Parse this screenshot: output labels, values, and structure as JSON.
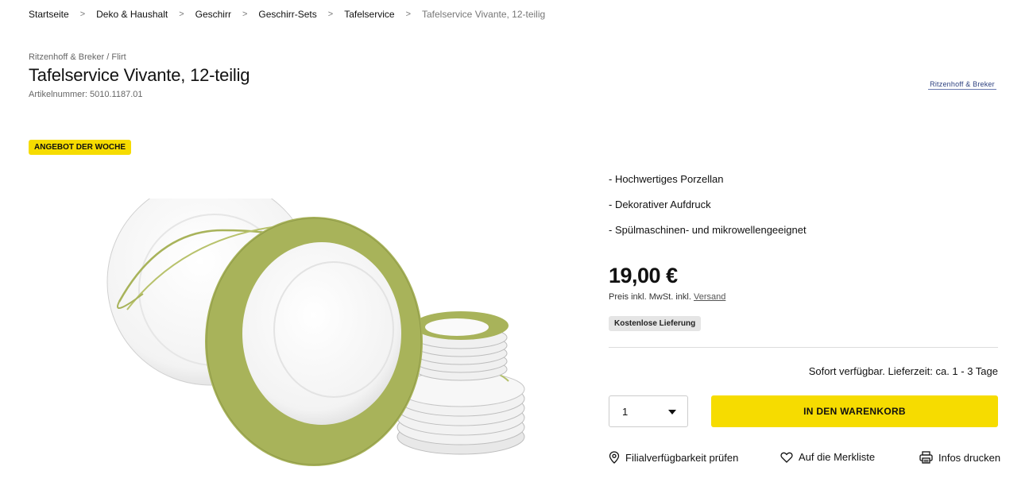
{
  "breadcrumb": {
    "items": [
      "Startseite",
      "Deko & Haushalt",
      "Geschirr",
      "Geschirr-Sets",
      "Tafelservice"
    ],
    "current": "Tafelservice Vivante, 12-teilig"
  },
  "product": {
    "brand_line": "Ritzenhoff & Breker / Flirt",
    "title": "Tafelservice Vivante, 12-teilig",
    "article_number": "Artikelnummer: 5010.1187.01",
    "brand_logo_text": "Ritzenhoff & Breker",
    "badge": "ANGEBOT DER WOCHE",
    "features": [
      "- Hochwertiges Porzellan",
      "- Dekorativer Aufdruck",
      "- Spülmaschinen- und mikrowellengeeignet"
    ],
    "price": "19,00 €",
    "price_note_prefix": "Preis inkl. MwSt. inkl.",
    "price_note_link": "Versand",
    "delivery_badge": "Kostenlose Lieferung",
    "availability": "Sofort verfügbar. Lieferzeit: ca. 1 - 3 Tage"
  },
  "purchase": {
    "quantity": "1",
    "cart_button": "IN DEN WARENKORB"
  },
  "actions": {
    "store": "Filialverfügbarkeit prüfen",
    "wishlist": "Auf die Merkliste",
    "print": "Infos drucken"
  },
  "icons": {
    "store": "location-pin-icon",
    "wishlist": "heart-icon",
    "print": "printer-icon",
    "quantity": "chevron-down-icon"
  },
  "colors": {
    "accent": "#f6dc00",
    "plate_rim": "#a8b35a",
    "link": "#555555"
  }
}
